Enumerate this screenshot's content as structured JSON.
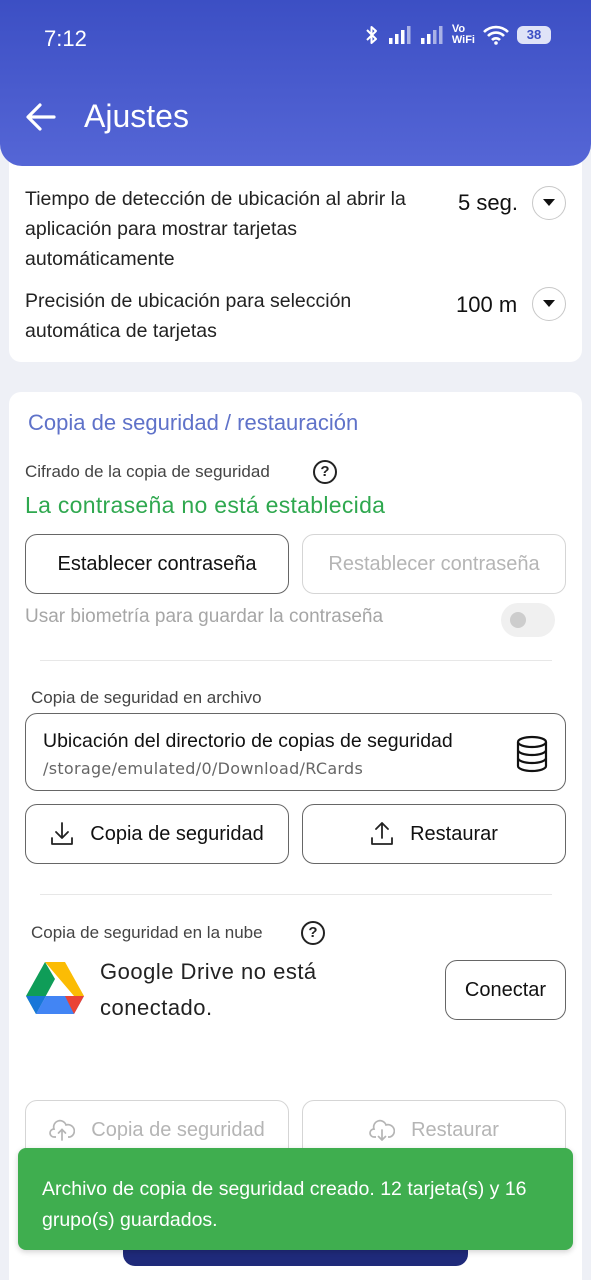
{
  "status_bar": {
    "time": "7:12",
    "vowifi_top": "Vo",
    "vowifi_bottom": "WiFi",
    "battery": "38"
  },
  "header": {
    "title": "Ajustes"
  },
  "location_settings": {
    "detection_time": {
      "label": "Tiempo de detección de ubicación al abrir la aplicación para mostrar tarjetas automáticamente",
      "value": "5 seg."
    },
    "precision": {
      "label": "Precisión de ubicación para selección automática de tarjetas",
      "value": "100 m"
    }
  },
  "backup": {
    "section_title": "Copia de seguridad / restauración",
    "encryption_label": "Cifrado de la copia de seguridad",
    "password_status": "La contraseña no está establecida",
    "set_password_button": "Establecer contraseña",
    "reset_password_button": "Restablecer contraseña",
    "biometrics_label": "Usar biometría para guardar la contraseña",
    "file": {
      "section_label": "Copia de seguridad en archivo",
      "directory_title": "Ubicación del directorio de copias de seguridad",
      "directory_path": "/storage/emulated/0/Download/RCards",
      "backup_button": "Copia de seguridad",
      "restore_button": "Restaurar"
    },
    "cloud": {
      "section_label": "Copia de seguridad en la nube",
      "drive_status": "Google Drive no está conectado.",
      "connect_button": "Conectar",
      "backup_button": "Copia de seguridad",
      "restore_button": "Restaurar"
    }
  },
  "snackbar": {
    "message": "Archivo de copia de seguridad creado. 12 tarjeta(s) y 16 grupo(s) guardados."
  },
  "colors": {
    "header": "#3c4fc4",
    "accent": "#5f72c9",
    "success": "#2fa84f",
    "snackbar": "#3fae4f"
  }
}
